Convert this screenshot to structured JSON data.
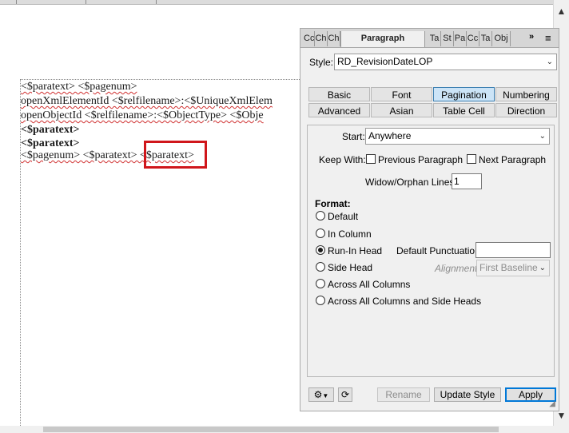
{
  "document": {
    "lines": [
      "<$paratext> <$pagenum>",
      "openXmlElementId <$relfilename>:<$UniqueXmlElem",
      "openObjectId <$relfilename>:<$ObjectType> <$Obje",
      "<$paratext>",
      "<$paratext>",
      "<$pagenum> <$paratext> <$paratext>"
    ]
  },
  "panel": {
    "tabs": [
      "Cc",
      "Ch",
      "Ch",
      "Paragraph Designer",
      "Ta",
      "St",
      "Pa",
      "Cc",
      "Ta",
      "Obj"
    ],
    "overflow": "»",
    "menu": "≡",
    "style_label": "Style:",
    "style_value": "RD_RevisionDateLOP",
    "property_tabs": [
      {
        "label": "Basic",
        "active": false
      },
      {
        "label": "Font",
        "active": false
      },
      {
        "label": "Pagination",
        "active": true
      },
      {
        "label": "Numbering",
        "active": false
      },
      {
        "label": "Advanced",
        "active": false
      },
      {
        "label": "Asian",
        "active": false
      },
      {
        "label": "Table Cell",
        "active": false
      },
      {
        "label": "Direction",
        "active": false
      }
    ],
    "start_label": "Start:",
    "start_value": "Anywhere",
    "keep_with_label": "Keep With:",
    "prev_para_label": "Previous Paragraph",
    "next_para_label": "Next Paragraph",
    "widow_label": "Widow/Orphan Lines:",
    "widow_value": "1",
    "format_label": "Format:",
    "format_options": [
      {
        "label": "Default",
        "checked": false
      },
      {
        "label": "In Column",
        "checked": false
      },
      {
        "label": "Run-In Head",
        "checked": true
      },
      {
        "label": "Side Head",
        "checked": false
      },
      {
        "label": "Across All Columns",
        "checked": false
      },
      {
        "label": "Across All Columns and Side Heads",
        "checked": false
      }
    ],
    "default_punct_label": "Default Punctuation:",
    "default_punct_value": "",
    "alignment_label": "Alignment:",
    "alignment_value": "First Baseline",
    "buttons": {
      "rename": "Rename",
      "update_style": "Update Style",
      "apply": "Apply"
    }
  }
}
